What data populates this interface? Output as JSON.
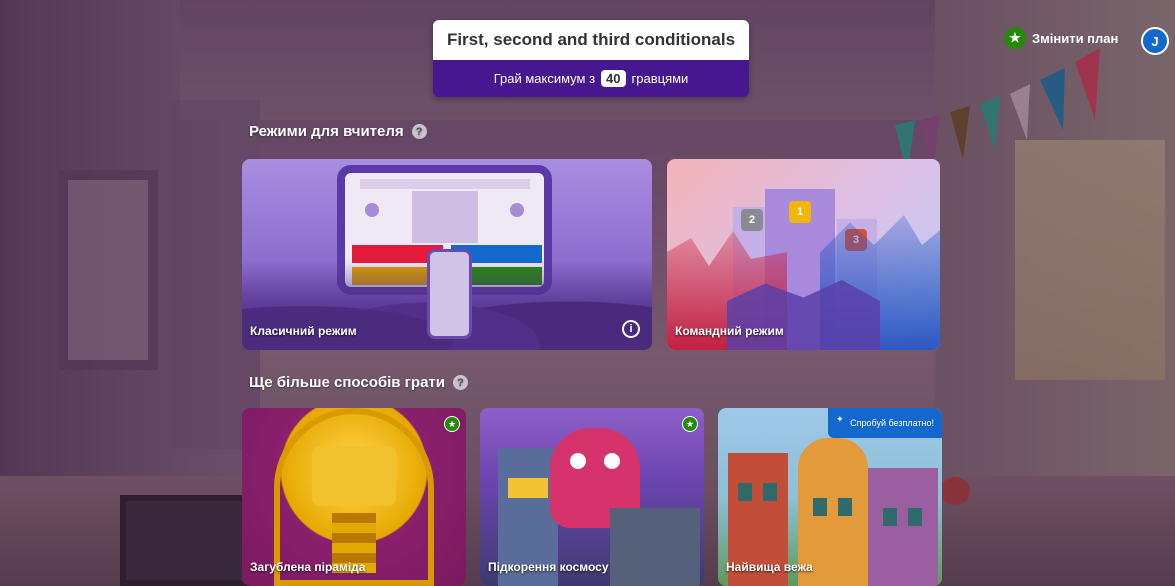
{
  "header": {
    "kahoot_title": "First, second and third conditionals",
    "players_prefix": "Грай максимум з",
    "players_count": "40",
    "players_suffix": "гравцями"
  },
  "top_right": {
    "upgrade_label": "Змінити план",
    "avatar_initial": "J"
  },
  "teacher_modes": {
    "section_title": "Режими для вчителя",
    "help_icon": "?",
    "cards": [
      {
        "label": "Класичний режим",
        "icon": "info-icon"
      },
      {
        "label": "Командний режим"
      }
    ],
    "team_medals": [
      "1",
      "2",
      "3"
    ]
  },
  "more_ways": {
    "section_title": "Ще більше способів грати",
    "help_icon": "?",
    "cards": [
      {
        "label": "Загублена піраміда",
        "badge": "star-icon"
      },
      {
        "label": "Підкорення космосу",
        "badge": "star-icon"
      },
      {
        "label": "Найвища вежа",
        "promo": "Спробуй безплатно!"
      }
    ]
  },
  "colors": {
    "purple": "#46178f",
    "red": "#e21b3c",
    "blue": "#1368ce",
    "yellow": "#d89e00",
    "green": "#26890c"
  }
}
